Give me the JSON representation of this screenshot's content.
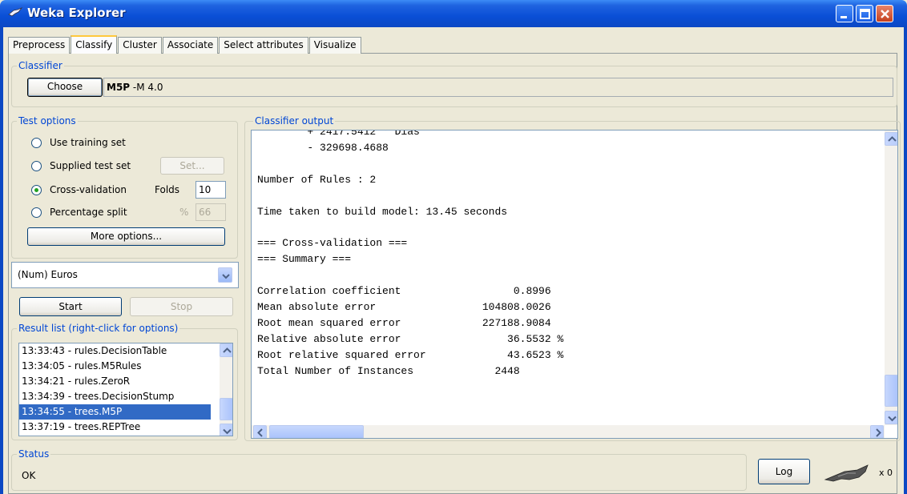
{
  "window": {
    "title": "Weka Explorer"
  },
  "tabs": [
    {
      "label": "Preprocess",
      "active": false
    },
    {
      "label": "Classify",
      "active": true
    },
    {
      "label": "Cluster",
      "active": false
    },
    {
      "label": "Associate",
      "active": false
    },
    {
      "label": "Select attributes",
      "active": false
    },
    {
      "label": "Visualize",
      "active": false
    }
  ],
  "classifier": {
    "group_title": "Classifier",
    "choose_label": "Choose",
    "name": "M5P",
    "options": "-M 4.0"
  },
  "test_options": {
    "group_title": "Test options",
    "use_training_set": "Use training set",
    "supplied_test_set": "Supplied test set",
    "set_button": "Set...",
    "cross_validation": "Cross-validation",
    "folds_label": "Folds",
    "folds_value": "10",
    "percentage_split": "Percentage split",
    "percent_symbol": "%",
    "percent_value": "66",
    "selected": "cross_validation",
    "more_options": "More options..."
  },
  "class_attribute": {
    "value": "(Num) Euros"
  },
  "run": {
    "start_label": "Start",
    "stop_label": "Stop"
  },
  "result_list": {
    "group_title": "Result list (right-click for options)",
    "items": [
      {
        "label": "13:33:43 - rules.DecisionTable",
        "selected": false
      },
      {
        "label": "13:34:05 - rules.M5Rules",
        "selected": false
      },
      {
        "label": "13:34:21 - rules.ZeroR",
        "selected": false
      },
      {
        "label": "13:34:39 - trees.DecisionStump",
        "selected": false
      },
      {
        "label": "13:34:55 - trees.M5P",
        "selected": true
      },
      {
        "label": "13:37:19 - trees.REPTree",
        "selected": false
      }
    ]
  },
  "output": {
    "group_title": "Classifier output",
    "lines": [
      "        + 2417.5412 * Dias",
      "        - 329698.4688",
      "",
      "Number of Rules : 2",
      "",
      "Time taken to build model: 13.45 seconds",
      "",
      "=== Cross-validation ===",
      "=== Summary ===",
      "",
      "Correlation coefficient                  0.8996",
      "Mean absolute error                 104808.0026",
      "Root mean squared error             227188.9084",
      "Relative absolute error                 36.5532 %",
      "Root relative squared error             43.6523 %",
      "Total Number of Instances             2448"
    ]
  },
  "status": {
    "group_title": "Status",
    "text": "OK",
    "log_label": "Log",
    "task_count": "x 0"
  },
  "colors": {
    "titlebar": "#0b48c4",
    "group_title": "#0046d5",
    "selection": "#316ac5",
    "tab_highlight": "#ffc83c"
  }
}
